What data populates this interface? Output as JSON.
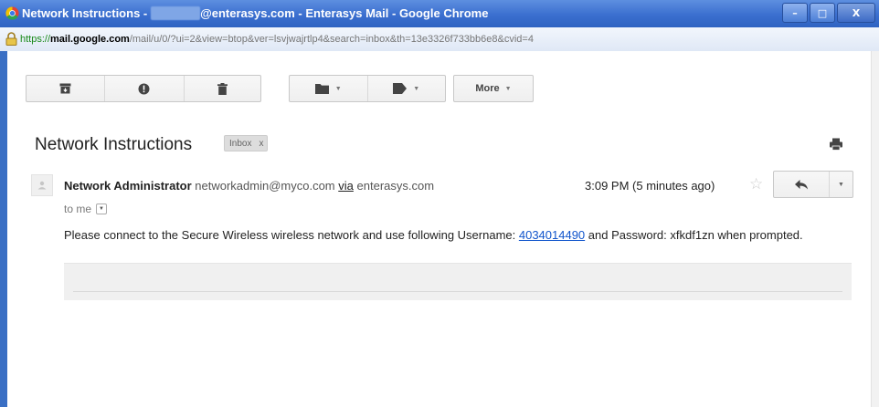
{
  "window": {
    "title_prefix": "Network Instructions - ",
    "title_redacted": "redacted",
    "title_suffix": "@enterasys.com - Enterasys Mail - Google Chrome",
    "controls": {
      "minimize": "–",
      "maximize": "□",
      "close": "X"
    }
  },
  "address": {
    "scheme": "https://",
    "host": "mail.google.com",
    "path": "/mail/u/0/?ui=2&view=btop&ver=lsvjwajrtlp4&search=inbox&th=13e3326f733bb6e8&cvid=4"
  },
  "toolbar": {
    "archive_icon": "archive-icon",
    "spam_icon": "report-spam-icon",
    "delete_icon": "trash-icon",
    "move_icon": "folder-icon",
    "label_icon": "tag-icon",
    "more_label": "More"
  },
  "email": {
    "subject": "Network Instructions",
    "label": "Inbox",
    "label_remove": "x",
    "sender_name": "Network Administrator",
    "sender_email": "networkadmin@myco.com",
    "via_word": "via",
    "via_domain": "enterasys.com",
    "recipient": "to me",
    "time": "3:09 PM (5 minutes ago)",
    "body_part1": "Please connect to the Secure Wireless wireless network and use following Username: ",
    "username": "4034014490",
    "body_part2": " and Password: xfkdf1zn when prompted."
  },
  "colors": {
    "titlebar": "#3b6fcf",
    "link": "#1155cc",
    "https": "#1a8a1a"
  }
}
